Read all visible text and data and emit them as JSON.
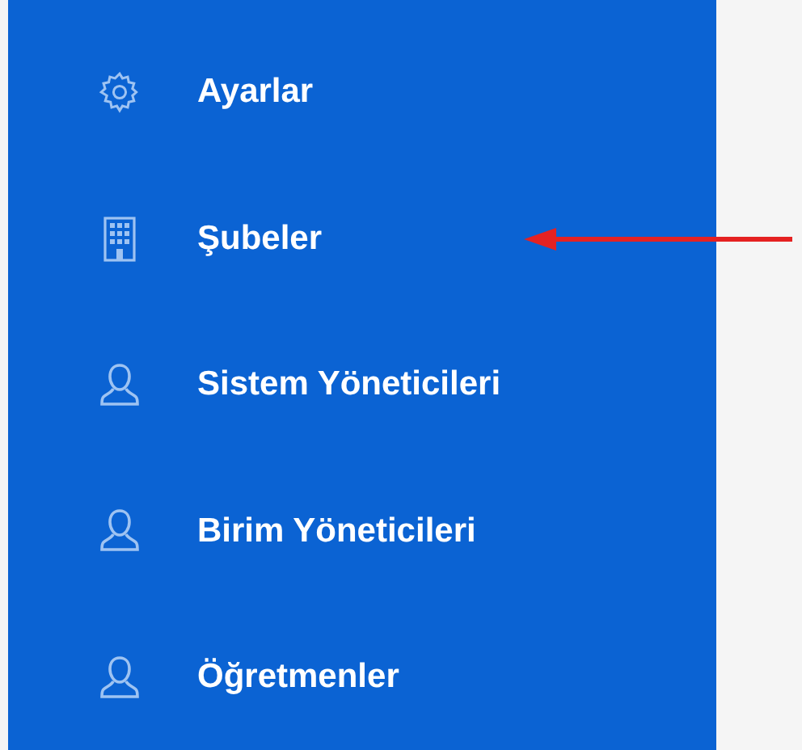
{
  "sidebar": {
    "items": [
      {
        "label": "Ayarlar"
      },
      {
        "label": "Şubeler"
      },
      {
        "label": "Sistem Yöneticileri"
      },
      {
        "label": "Birim Yöneticileri"
      },
      {
        "label": "Öğretmenler"
      }
    ]
  }
}
